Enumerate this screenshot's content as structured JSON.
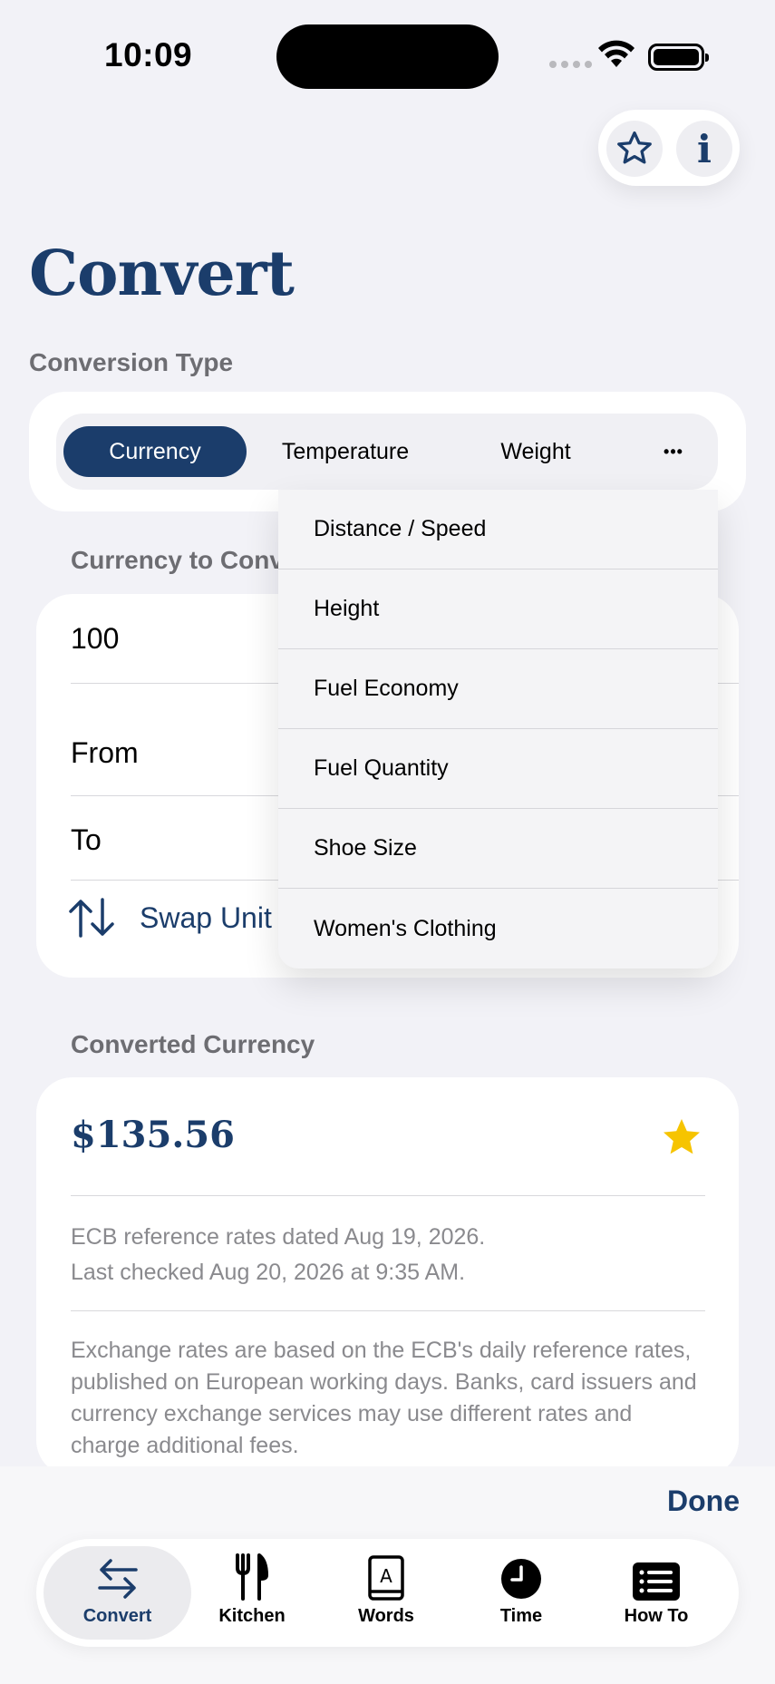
{
  "status_bar": {
    "time": "10:09"
  },
  "title": "Convert",
  "conversion_type": {
    "label": "Conversion Type",
    "segments": [
      "Currency",
      "Temperature",
      "Weight"
    ],
    "more_label": "•••"
  },
  "dropdown": {
    "items": [
      "Distance / Speed",
      "Height",
      "Fuel Economy",
      "Fuel Quantity",
      "Shoe Size",
      "Women's Clothing"
    ]
  },
  "input": {
    "section_label": "Currency to Conv",
    "amount": "100",
    "from_label": "From",
    "to_label": "To",
    "swap_label": "Swap Unit"
  },
  "result": {
    "section_label": "Converted Currency",
    "value": "$135.56",
    "rates_line1": "ECB reference rates dated Aug 19, 2026.",
    "rates_line2": "Last checked Aug 20, 2026 at 9:35 AM.",
    "disclaimer": "Exchange rates are based on the ECB's daily reference rates, published on European working days. Banks, card issuers and currency exchange services may use different rates and charge additional fees."
  },
  "done_label": "Done",
  "tabs": [
    {
      "label": "Convert",
      "icon": "arrows-swap-icon"
    },
    {
      "label": "Kitchen",
      "icon": "fork-knife-icon"
    },
    {
      "label": "Words",
      "icon": "dictionary-icon"
    },
    {
      "label": "Time",
      "icon": "clock-icon"
    },
    {
      "label": "How To",
      "icon": "list-icon"
    }
  ],
  "colors": {
    "accent": "#1b3d6b",
    "favorite": "#f6c400",
    "background": "#f2f2f7"
  }
}
